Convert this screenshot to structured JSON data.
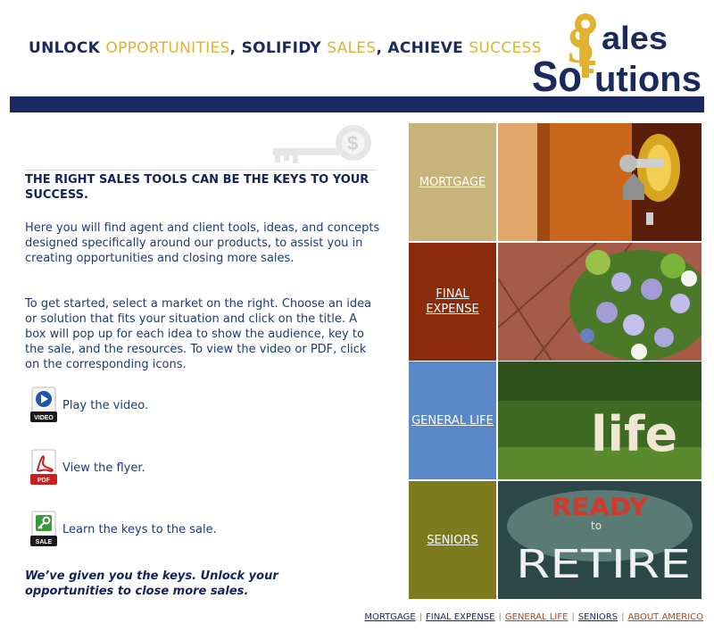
{
  "header": {
    "tagline": [
      {
        "text": "UNLOCK ",
        "style": "dark"
      },
      {
        "text": "OPPORTUNITIES",
        "style": "gold"
      },
      {
        "text": ", SOLIFIDY ",
        "style": "dark"
      },
      {
        "text": "SALES",
        "style": "gold"
      },
      {
        "text": ", ACHIEVE ",
        "style": "dark"
      },
      {
        "text": "SUCCESS",
        "style": "gold"
      }
    ],
    "logo_line1": "ales",
    "logo_line2_a": "So",
    "logo_line2_b": "utions",
    "logo_dollar": "$"
  },
  "intro": {
    "heading": "THE RIGHT SALES TOOLS CAN BE THE KEYS TO YOUR SUCCESS.",
    "paragraph1": "Here you will find agent and client tools, ideas, and concepts designed specifically around our products, to assist you in creating opportunities and closing more sales.",
    "paragraph2": "To get started, select a market on the right. Choose an idea or solution that fits your situation and click on the title. A box will pop up for each idea to show the audience, key to the sale, and the resources. To view the video or PDF, click on the corresponding icons.",
    "closing": "We’ve given you the keys. Unlock your opportunities to close more sales."
  },
  "actions": [
    {
      "label": "Play the video.",
      "icon": "video-icon",
      "badge": "VIDEO"
    },
    {
      "label": "View the flyer.",
      "icon": "pdf-icon",
      "badge": "PDF"
    },
    {
      "label": "Learn the keys to the sale.",
      "icon": "sale-key-icon",
      "badge": "SALE"
    }
  ],
  "markets": [
    {
      "label": "MORTGAGE",
      "photo": "key-in-door-photo"
    },
    {
      "label": "FINAL EXPENSE",
      "photo": "flowers-photo"
    },
    {
      "label": "GENERAL LIFE",
      "photo": "life-letters-on-grass-photo",
      "photo_text": "life"
    },
    {
      "label": "SENIORS",
      "photo": "ready-to-retire-photo",
      "photo_text_top": "READY",
      "photo_text_mid": "to",
      "photo_text_bottom": "RETIRE"
    }
  ],
  "footer_links": [
    {
      "label": "MORTGAGE",
      "color": "#1b2a5e"
    },
    {
      "label": "FINAL EXPENSE",
      "color": "#1b2a5e"
    },
    {
      "label": "GENERAL LIFE",
      "color": "#b5451b"
    },
    {
      "label": "SENIORS",
      "color": "#1b2a5e"
    },
    {
      "label": "ABOUT AMERICO",
      "color": "#b5451b"
    }
  ],
  "colors": {
    "navy": "#1b2a5e",
    "gold": "#e1b230",
    "mortgage": "#c8b47a",
    "final_expense": "#8a2c0c",
    "general_life": "#5a87c8",
    "seniors": "#7e7a1e"
  }
}
